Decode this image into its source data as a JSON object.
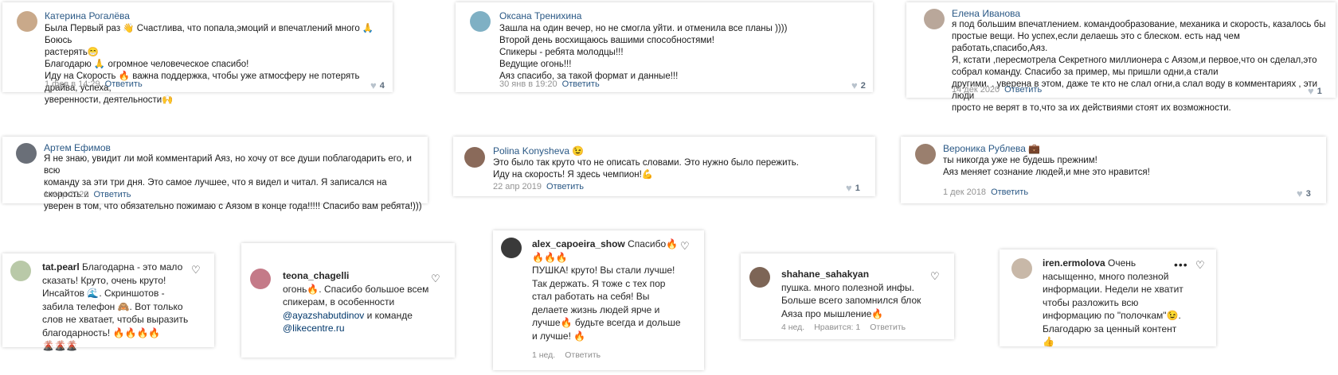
{
  "vk_comments": [
    {
      "name": "Катерина Рогалёва",
      "text": "Была Первый раз 👋 Счастлива, что попала,эмоций и впечатлений много 🙏 Боюсь\nрастерять😁\nБлагодарю 🙏 огромное человеческое спасибо!\nИду на Скорость 🔥 важна поддержка, чтобы уже атмосферу не потерять драйва, успеха,\nуверенности, деятельности🙌",
      "date": "1 фев в 14:29",
      "reply": "Ответить",
      "likes": "4",
      "avatar_color": "#c9a98a"
    },
    {
      "name": "Оксана Тренихина",
      "text": "Зашла на один вечер, но не смогла уйти. и отменила все планы ))))\nВторой день восхищаюсь вашими способностями!\nСпикеры - ребята молодцы!!!\nВедущие огонь!!!\nАяз спасибо, за такой формат и данные!!!",
      "date": "30 янв в 19:20",
      "reply": "Ответить",
      "likes": "2",
      "avatar_color": "#7fb0c4"
    },
    {
      "name": "Елена Иванова",
      "text": "я под большим впечатлением. командообразование, механика и скорость, казалось бы\nпростые вещи. Но успех,если делаешь это с блеском. есть над чем работать,спасибо,Аяз.\nЯ, кстати ,пересмотрела Секретного миллионера с Аязом,и первое,что он сделал,это\nсобрал команду. Спасибо за пример, мы пришли одни,а стали\nдругими. . уверена в этом, даже те кто не слал огни,а слал воду в комментариях , эти люди\nпросто не верят в то,что за их действиями стоят их возможности.",
      "date": "14 дек 2020",
      "reply": "Ответить",
      "likes": "1",
      "avatar_color": "#b9a79a"
    },
    {
      "name": "Артем Ефимов",
      "text": "Я не знаю, увидит ли мой комментарий Аяз, но хочу от все души поблагодарить его, и всю\nкоманду за эти три дня. Это самое лучшее, что я видел и читал. Я записался на скорость и\nуверен в том, что обязательно пожимаю с Аязом в конце года!!!!! Спасибо вам ребята!)))",
      "date": "1 мар 2020",
      "reply": "Ответить",
      "likes": "",
      "avatar_color": "#6a6f78"
    },
    {
      "name": "Polina Konysheva 😉",
      "text": "Это было так круто что не описать словами. Это нужно было пережить.\nИду на скорость! Я здесь чемпион!💪",
      "date": "22 апр 2019",
      "reply": "Ответить",
      "likes": "1",
      "avatar_color": "#8a6a5a"
    },
    {
      "name": "Вероника Рублева 💼",
      "text": "ты никогда уже не будешь прежним!\nАяз меняет сознание людей,и мне это нравится!",
      "date": "1 дек 2018",
      "reply": "Ответить",
      "likes": "3",
      "avatar_color": "#9a7f6e"
    }
  ],
  "ig_comments": [
    {
      "username": "tat.pearl",
      "text": " Благодарна - это мало\nсказать! Круто, очень круто!\nИнсайтов 🌊. Скриншотов -\nзабила телефон 🙈. Вот только\nслов не хватает, чтобы выразить\nблагодарность! 🔥🔥🔥🔥\n🌋🌋🌋",
      "avatar_color": "#b9c9a8"
    },
    {
      "username": "teona_chagelli",
      "text": "огонь🔥. Спасибо большое всем\nспикерам, в особенности\n",
      "mention1": "@ayazshabutdinov",
      "mid": " и команде\n",
      "mention2": "@likecentre.ru",
      "avatar_color": "#c47a88"
    },
    {
      "username": "alex_capoeira_show",
      "text": " Спасибо🔥\n🔥🔥🔥\nПУШКА! круто! Вы стали лучше!\nТак держать. Я тоже с тех пор\nстал работать на себя! Вы\nделаете жизнь людей ярче и\nлучше🔥 будьте всегда и дольше\nи лучше! 🔥",
      "time": "1 нед.",
      "reply": "Ответить",
      "avatar_color": "#3a3a3a"
    },
    {
      "username": "shahane_sahakyan",
      "text": "пушка. много полезной инфы.\nБольше всего запомнился блок\nАяза про мышление🔥",
      "time": "4 нед.",
      "likes_label": "Нравится: 1",
      "reply": "Ответить",
      "avatar_color": "#7d6556"
    },
    {
      "username": "iren.ermolova",
      "text": " Очень\nнасыщенно, много полезной\nинформации. Недели не хватит\nчтобы разложить всю\nинформацию по \"полочкам\"😉.\nБлагодарю за ценный контент\n👍",
      "avatar_color": "#c8b8a8",
      "dots": "•••"
    }
  ],
  "icons": {
    "heart": "heart-icon",
    "more": "more-icon"
  }
}
